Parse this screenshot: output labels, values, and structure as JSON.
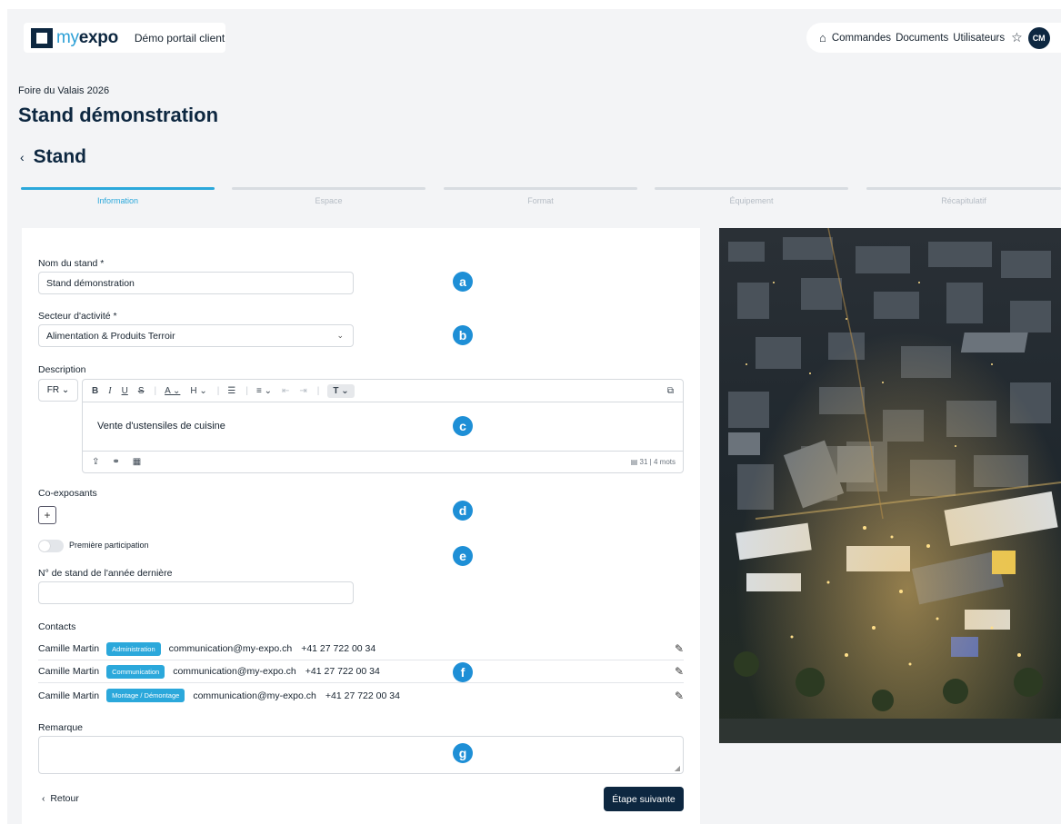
{
  "header": {
    "logo_light": "my",
    "logo_bold": "expo",
    "portal_name": "Démo portail client",
    "nav": [
      "Commandes",
      "Documents",
      "Utilisateurs"
    ],
    "avatar_initials": "CM"
  },
  "event_name": "Foire du Valais 2026",
  "page_title": "Stand démonstration",
  "section_title": "Stand",
  "steps": [
    "Information",
    "Espace",
    "Format",
    "Équipement",
    "Récapitulatif"
  ],
  "active_step": 0,
  "form": {
    "stand_name_label": "Nom du stand *",
    "stand_name_value": "Stand démonstration",
    "sector_label": "Secteur d'activité *",
    "sector_value": "Alimentation & Produits Terroir",
    "description_label": "Description",
    "description_lang": "FR",
    "description_text": "Vente d'ustensiles de cuisine",
    "char_count": "31",
    "word_count": "4 mots",
    "coexhibitors_label": "Co-exposants",
    "first_participation_label": "Première participation",
    "first_participation_on": false,
    "last_year_stand_label": "N° de stand de l'année dernière",
    "last_year_stand_value": "",
    "contacts_label": "Contacts",
    "remark_label": "Remarque",
    "remark_value": "",
    "back_label": "Retour",
    "next_label": "Étape suivante"
  },
  "contacts": [
    {
      "name": "Camille Martin",
      "role": "Administration",
      "email": "communication@my-expo.ch",
      "phone": "+41 27 722 00 34"
    },
    {
      "name": "Camille Martin",
      "role": "Communication",
      "email": "communication@my-expo.ch",
      "phone": "+41 27 722 00 34"
    },
    {
      "name": "Camille Martin",
      "role": "Montage / Démontage",
      "email": "communication@my-expo.ch",
      "phone": "+41 27 722 00 34"
    }
  ],
  "annotations": [
    "a",
    "b",
    "c",
    "d",
    "e",
    "f",
    "g"
  ],
  "colors": {
    "brand_navy": "#0d2740",
    "accent_blue": "#2ba8db",
    "annotation_blue": "#1e8fd6"
  }
}
